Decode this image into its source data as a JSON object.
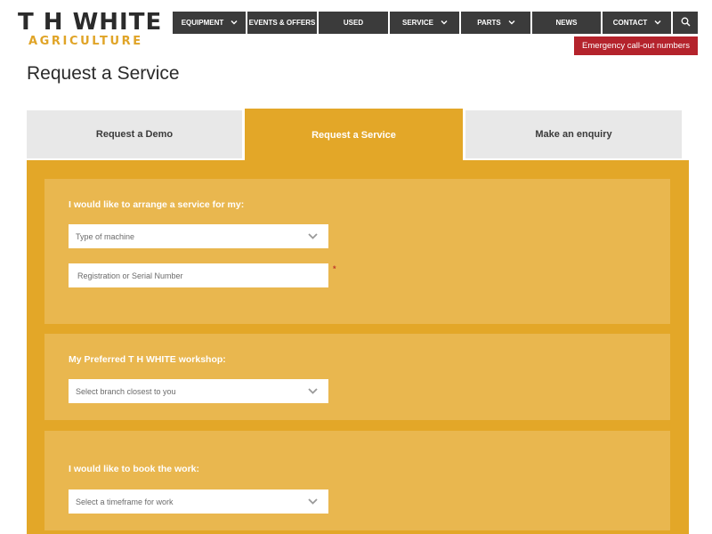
{
  "logo": {
    "main": "T H WHITE",
    "sub": "AGRICULTURE"
  },
  "nav": {
    "items": [
      {
        "label": "EQUIPMENT",
        "dropdown": true
      },
      {
        "label": "EVENTS & OFFERS",
        "dropdown": false
      },
      {
        "label": "USED",
        "dropdown": false
      },
      {
        "label": "SERVICE",
        "dropdown": true
      },
      {
        "label": "PARTS",
        "dropdown": true
      },
      {
        "label": "NEWS",
        "dropdown": false
      },
      {
        "label": "CONTACT",
        "dropdown": true
      }
    ],
    "search_icon": "search-icon"
  },
  "emergency_label": "Emergency call-out numbers",
  "page_title": "Request a Service",
  "tabs": [
    {
      "label": "Request a Demo",
      "active": false
    },
    {
      "label": "Request a Service",
      "active": true
    },
    {
      "label": "Make an enquiry",
      "active": false
    }
  ],
  "form": {
    "section1": {
      "label": "I would like to arrange a service for my:",
      "machine_select": "Type of machine",
      "serial_placeholder": "Registration or Serial Number",
      "required_mark": "*"
    },
    "section2": {
      "label": "My Preferred T H WHITE workshop:",
      "branch_select": "Select branch closest to you"
    },
    "section3": {
      "label": "I would like to book the work:",
      "timeframe_select": "Select a timeframe for work"
    }
  },
  "colors": {
    "brand_gold": "#e3a728",
    "panel_gold": "#e9b74f",
    "nav_dark": "#3b3b3b",
    "emergency_red": "#b4232c"
  }
}
